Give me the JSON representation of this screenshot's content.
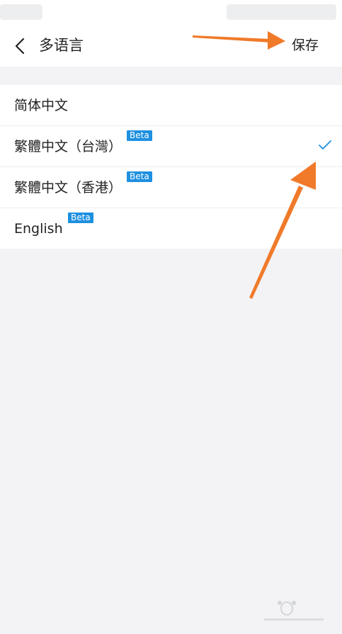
{
  "nav": {
    "title": "多语言",
    "save_label": "保存"
  },
  "languages": [
    {
      "label": "简体中文",
      "beta": false,
      "selected": false
    },
    {
      "label": "繁體中文（台灣）",
      "beta": true,
      "beta_label": "Beta",
      "selected": true
    },
    {
      "label": "繁體中文（香港）",
      "beta": true,
      "beta_label": "Beta",
      "selected": false
    },
    {
      "label": "English",
      "beta": true,
      "beta_label": "Beta",
      "selected": false
    }
  ],
  "colors": {
    "accent": "#1e90e0",
    "annotation_arrow": "#f07a2a"
  },
  "icons": {
    "back": "chevron-left-icon",
    "selected": "checkmark-icon"
  }
}
